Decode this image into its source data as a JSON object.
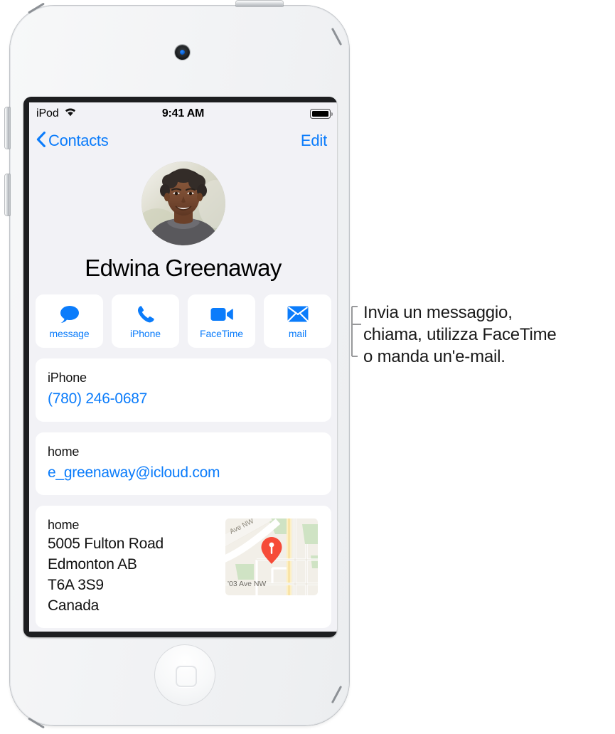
{
  "device": {
    "name": "ipod-touch",
    "camera": "front-camera",
    "home_button": "home-button"
  },
  "status_bar": {
    "carrier": "iPod",
    "wifi_icon": "wifi-icon",
    "time": "9:41 AM",
    "battery_icon": "battery-full-icon"
  },
  "nav_bar": {
    "back_icon": "chevron-left-icon",
    "back_label": "Contacts",
    "edit_label": "Edit"
  },
  "contact": {
    "avatar": "contact-photo",
    "name": "Edwina Greenaway"
  },
  "actions": [
    {
      "icon": "message-bubble-icon",
      "label": "message"
    },
    {
      "icon": "phone-handset-icon",
      "label": "iPhone"
    },
    {
      "icon": "video-camera-icon",
      "label": "FaceTime"
    },
    {
      "icon": "envelope-icon",
      "label": "mail"
    }
  ],
  "fields": {
    "phone": {
      "label": "iPhone",
      "value": "(780) 246-0687"
    },
    "email": {
      "label": "home",
      "value": "e_greenaway@icloud.com"
    },
    "address": {
      "label": "home",
      "lines": [
        "5005 Fulton Road",
        "Edmonton AB",
        "T6A 3S9",
        "Canada"
      ],
      "map_icon": "map-thumbnail",
      "map_pin_icon": "map-pin-icon",
      "map_street_labels": [
        "Ave NW",
        "'03 Ave NW"
      ]
    }
  },
  "callout": {
    "bracket_icon": "callout-bracket-icon",
    "text": "Invia un messaggio,\nchiama, utilizza FaceTime\no manda un'e-mail."
  },
  "colors": {
    "accent_blue": "#0b7cfb",
    "screen_background": "#f2f2f6",
    "card_background": "#ffffff",
    "map_pin_red": "#f64b38",
    "text_primary": "#111111"
  }
}
